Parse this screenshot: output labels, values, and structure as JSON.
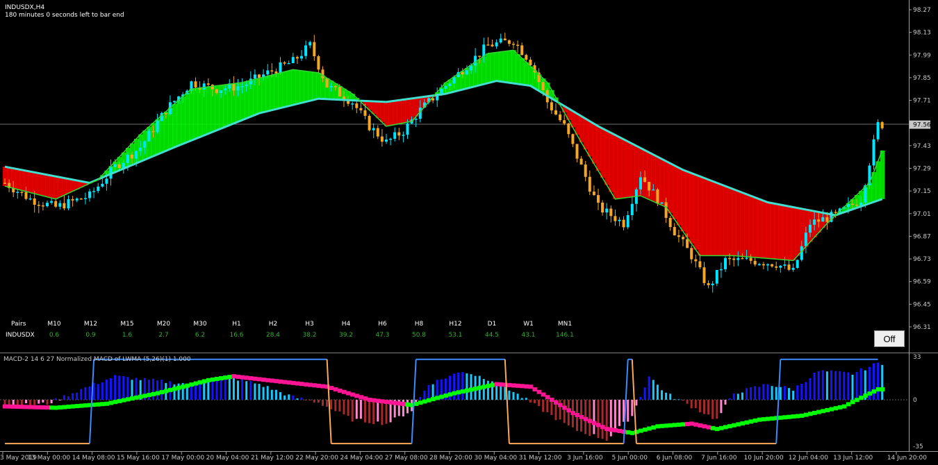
{
  "window": {
    "symbol_tf": "INDUSDX,H4",
    "timer": "180 minutes 0 seconds left to bar end"
  },
  "off_button": "Off",
  "price_axis": {
    "ticks": [
      "98.27",
      "98.13",
      "97.99",
      "97.85",
      "97.71",
      "97.56",
      "97.43",
      "97.29",
      "97.15",
      "97.01",
      "96.87",
      "96.73",
      "96.59",
      "96.45",
      "96.31"
    ],
    "current_price": "97.56",
    "range": [
      96.25,
      98.3
    ]
  },
  "strength_table": {
    "pairs_label": "Pairs",
    "timeframes": [
      "M10",
      "M12",
      "M15",
      "M20",
      "M30",
      "H1",
      "H2",
      "H3",
      "H4",
      "H6",
      "H8",
      "H12",
      "D1",
      "W1",
      "MN1"
    ],
    "symbol": "INDUSDX",
    "values": [
      "0.6",
      "0.9",
      "1.6",
      "2.7",
      "6.2",
      "16.6",
      "28.4",
      "38.2",
      "39.2",
      "47.3",
      "50.8",
      "53.1",
      "44.5",
      "43.1",
      "146.1"
    ]
  },
  "time_axis": [
    "3 May 2019",
    "13 May 00:00",
    "14 May 08:00",
    "15 May 16:00",
    "17 May 00:00",
    "20 May 04:00",
    "21 May 12:00",
    "22 May 20:00",
    "24 May 04:00",
    "27 May 08:00",
    "28 May 20:00",
    "30 May 04:00",
    "31 May 12:00",
    "3 Jun 16:00",
    "5 Jun 00:00",
    "6 Jun 08:00",
    "7 Jun 16:00",
    "10 Jun 20:00",
    "12 Jun 04:00",
    "13 Jun 12:00",
    "14 Jun 20:00"
  ],
  "indicator": {
    "label": "MACD-2 14 6 27 Normalized MACD of LWMA (5,26)(1) 1.000",
    "ticks": [
      "33",
      "0",
      "-35"
    ]
  },
  "colors": {
    "background": "#000000",
    "bull_candle": "#00e5ff",
    "bear_candle": "#f5a623",
    "fast_ma": "#35d835",
    "slow_ma": "#40e0d0",
    "cloud_bull": "#00ff00",
    "cloud_bear": "#ff0000",
    "macd_blue": "#1414ff",
    "macd_cyan": "#19c8ff",
    "macd_brown": "#a52a2a",
    "macd_pink": "#ff88cc",
    "signal_green": "#00ff00",
    "signal_magenta": "#ff1493",
    "step_line": "#3d8bff"
  },
  "chart_data": [
    {
      "type": "candlestick",
      "symbol": "INDUSDX",
      "timeframe": "H4",
      "y_range": [
        96.25,
        98.3
      ],
      "approx_close_path": [
        [
          0,
          97.2
        ],
        [
          6,
          97.1
        ],
        [
          12,
          97.05
        ],
        [
          20,
          97.12
        ],
        [
          26,
          97.3
        ],
        [
          32,
          97.42
        ],
        [
          38,
          97.65
        ],
        [
          44,
          97.82
        ],
        [
          50,
          97.78
        ],
        [
          56,
          97.8
        ],
        [
          62,
          97.88
        ],
        [
          68,
          97.95
        ],
        [
          72,
          98.05
        ],
        [
          76,
          97.8
        ],
        [
          82,
          97.7
        ],
        [
          86,
          97.55
        ],
        [
          90,
          97.45
        ],
        [
          94,
          97.52
        ],
        [
          98,
          97.65
        ],
        [
          102,
          97.75
        ],
        [
          108,
          97.9
        ],
        [
          114,
          98.05
        ],
        [
          120,
          98.08
        ],
        [
          124,
          97.95
        ],
        [
          128,
          97.7
        ],
        [
          132,
          97.55
        ],
        [
          136,
          97.3
        ],
        [
          140,
          97.05
        ],
        [
          146,
          96.95
        ],
        [
          150,
          97.25
        ],
        [
          154,
          97.1
        ],
        [
          158,
          96.9
        ],
        [
          162,
          96.75
        ],
        [
          166,
          96.55
        ],
        [
          170,
          96.72
        ],
        [
          176,
          96.72
        ],
        [
          182,
          96.7
        ],
        [
          186,
          96.65
        ],
        [
          190,
          96.95
        ],
        [
          196,
          97.0
        ],
        [
          202,
          97.1
        ],
        [
          206,
          97.56
        ]
      ],
      "fast_ma_path": [
        [
          0,
          97.18
        ],
        [
          12,
          97.1
        ],
        [
          22,
          97.22
        ],
        [
          32,
          97.5
        ],
        [
          44,
          97.78
        ],
        [
          56,
          97.82
        ],
        [
          68,
          97.9
        ],
        [
          74,
          97.88
        ],
        [
          82,
          97.75
        ],
        [
          90,
          97.55
        ],
        [
          96,
          97.58
        ],
        [
          104,
          97.82
        ],
        [
          114,
          98.0
        ],
        [
          120,
          98.02
        ],
        [
          128,
          97.82
        ],
        [
          136,
          97.45
        ],
        [
          144,
          97.1
        ],
        [
          150,
          97.12
        ],
        [
          156,
          97.05
        ],
        [
          164,
          96.75
        ],
        [
          172,
          96.75
        ],
        [
          186,
          96.72
        ],
        [
          194,
          96.95
        ],
        [
          204,
          97.2
        ],
        [
          207,
          97.4
        ]
      ],
      "slow_ma_path": [
        [
          0,
          97.3
        ],
        [
          20,
          97.2
        ],
        [
          40,
          97.42
        ],
        [
          60,
          97.63
        ],
        [
          74,
          97.72
        ],
        [
          90,
          97.7
        ],
        [
          104,
          97.75
        ],
        [
          116,
          97.83
        ],
        [
          124,
          97.8
        ],
        [
          140,
          97.55
        ],
        [
          160,
          97.28
        ],
        [
          180,
          97.08
        ],
        [
          196,
          97.0
        ],
        [
          207,
          97.1
        ]
      ]
    },
    {
      "type": "bar",
      "name": "MACD-2 14 6 27 Normalized MACD of LWMA (5,26)(1) 1.000",
      "y_range": [
        -35,
        33
      ],
      "histogram_anchors": [
        [
          0,
          -5
        ],
        [
          10,
          -3
        ],
        [
          18,
          8
        ],
        [
          26,
          18
        ],
        [
          34,
          15
        ],
        [
          44,
          12
        ],
        [
          52,
          18
        ],
        [
          60,
          12
        ],
        [
          68,
          2
        ],
        [
          74,
          -2
        ],
        [
          82,
          -15
        ],
        [
          90,
          -18
        ],
        [
          96,
          -8
        ],
        [
          100,
          12
        ],
        [
          108,
          22
        ],
        [
          116,
          14
        ],
        [
          122,
          2
        ],
        [
          126,
          -6
        ],
        [
          134,
          -22
        ],
        [
          142,
          -30
        ],
        [
          148,
          -12
        ],
        [
          152,
          18
        ],
        [
          156,
          5
        ],
        [
          162,
          -5
        ],
        [
          168,
          -15
        ],
        [
          172,
          5
        ],
        [
          180,
          12
        ],
        [
          186,
          8
        ],
        [
          192,
          22
        ],
        [
          200,
          20
        ],
        [
          206,
          28
        ]
      ],
      "signal_anchors": [
        [
          0,
          -5
        ],
        [
          12,
          -6
        ],
        [
          24,
          -3
        ],
        [
          36,
          5
        ],
        [
          48,
          15
        ],
        [
          54,
          18
        ],
        [
          62,
          15
        ],
        [
          76,
          10
        ],
        [
          86,
          0
        ],
        [
          96,
          -4
        ],
        [
          106,
          5
        ],
        [
          116,
          12
        ],
        [
          124,
          10
        ],
        [
          134,
          -10
        ],
        [
          142,
          -22
        ],
        [
          148,
          -25
        ],
        [
          154,
          -20
        ],
        [
          162,
          -18
        ],
        [
          168,
          -22
        ],
        [
          178,
          -15
        ],
        [
          188,
          -12
        ],
        [
          198,
          -5
        ],
        [
          206,
          8
        ]
      ],
      "step_line": [
        [
          0,
          -33
        ],
        [
          20,
          -33
        ],
        [
          21,
          31
        ],
        [
          76,
          31
        ],
        [
          77,
          -33
        ],
        [
          96,
          -33
        ],
        [
          97,
          31
        ],
        [
          118,
          31
        ],
        [
          119,
          -33
        ],
        [
          146,
          -33
        ],
        [
          147,
          31
        ],
        [
          148,
          31
        ],
        [
          149,
          -33
        ],
        [
          182,
          -33
        ],
        [
          183,
          31
        ],
        [
          206,
          31
        ]
      ]
    }
  ]
}
